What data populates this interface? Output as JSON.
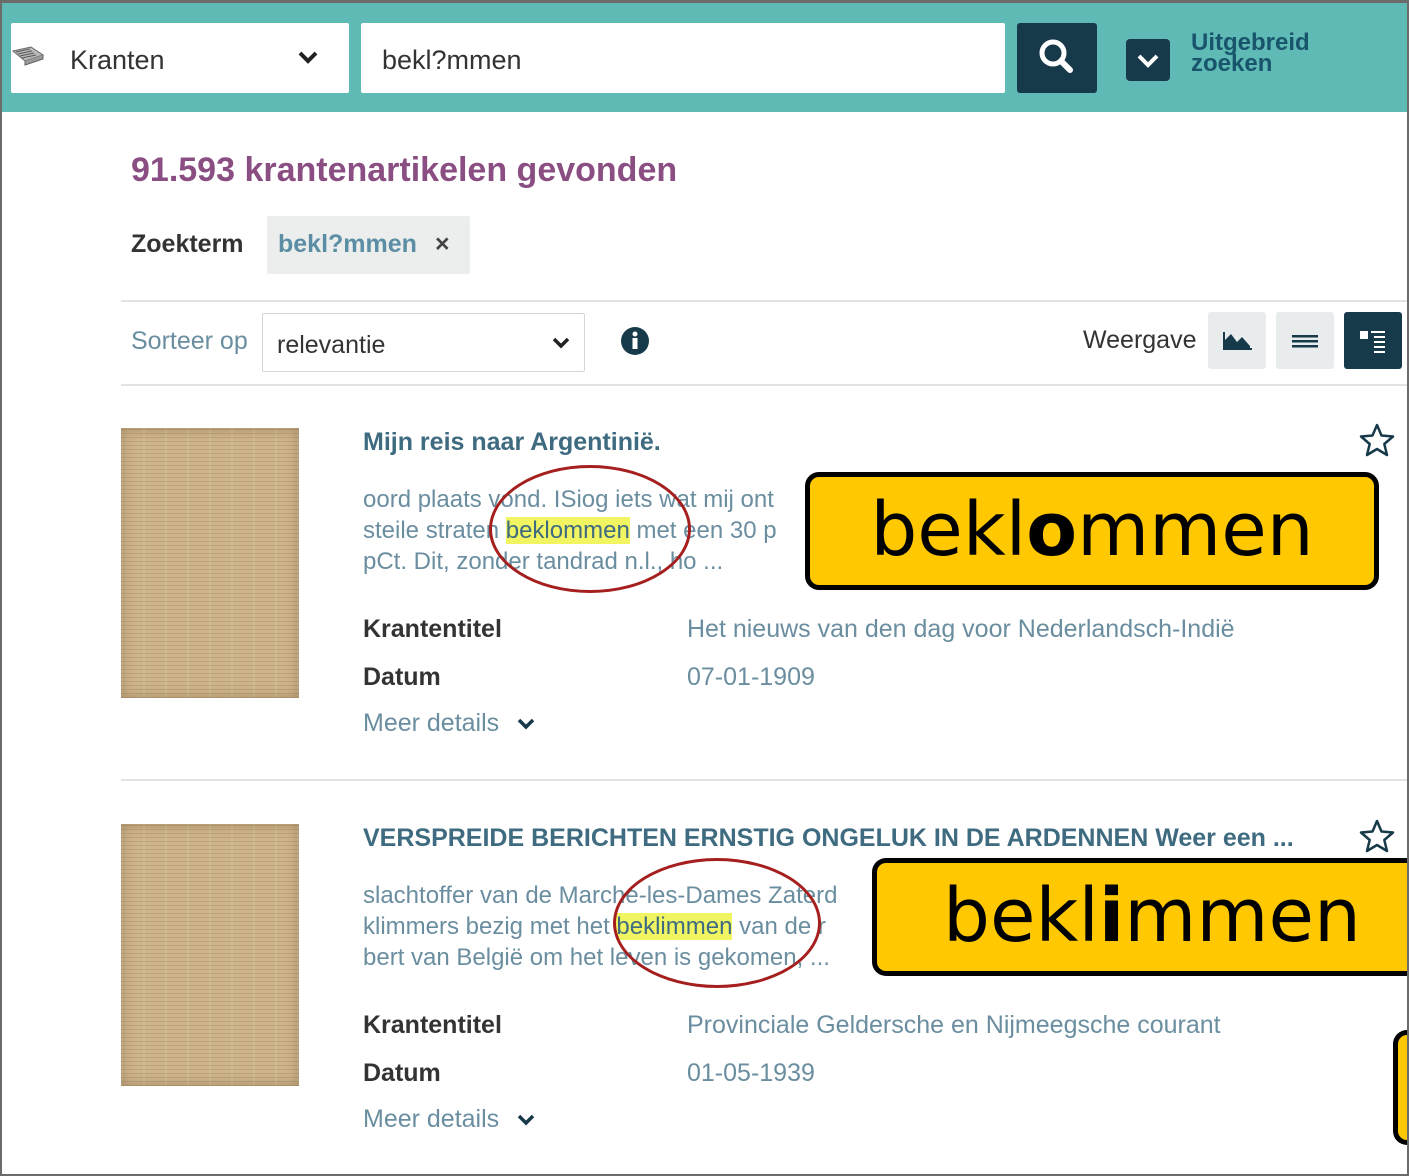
{
  "topbar": {
    "collection_label": "Kranten",
    "search_value": "bekl?mmen",
    "advanced_label": "Uitgebreid zoeken",
    "advanced_line1": "Uitgebreid",
    "advanced_line2": "zoeken"
  },
  "results": {
    "count_text": "91.593 krantenartikelen gevonden",
    "zoekterm_label": "Zoekterm",
    "zoekterm_value": "bekl?mmen",
    "zoekterm_remove": "×"
  },
  "toolbar": {
    "sort_label": "Sorteer op",
    "sort_value": "relevantie",
    "weergave_label": "Weergave"
  },
  "items": [
    {
      "title": "Mijn reis naar Argentinië.",
      "snippet_l1": "oord plaats vond. ISiog iets wat mij ont",
      "snippet_l2_pre": "steile straten ",
      "snippet_l2_hl": "beklommen",
      "snippet_l2_post": " met een 30 p",
      "snippet_l3": "pCt. Dit, zonder tandrad n.l., ho ...",
      "krantentitel_label": "Krantentitel",
      "krantentitel": "Het nieuws van den dag voor Nederlandsch-Indië",
      "datum_label": "Datum",
      "datum": "07-01-1909",
      "more_label": "Meer details"
    },
    {
      "title": "VERSPREIDE BERICHTEN ERNSTIG ONGELUK IN DE ARDENNEN Weer een ...",
      "snippet_l1": "slachtoffer van de Marche-les-Dames Zaterd",
      "snippet_l2_pre": "klimmers bezig met het ",
      "snippet_l2_hl": "beklimmen",
      "snippet_l2_post": " van de r",
      "snippet_l3": "bert van België om het leven is gekomen, ...",
      "krantentitel_label": "Krantentitel",
      "krantentitel": "Provinciale Geldersche en Nijmeegsche courant",
      "datum_label": "Datum",
      "datum": "01-05-1939",
      "more_label": "Meer details"
    }
  ],
  "callouts": [
    {
      "pre": "bekl",
      "bold": "o",
      "post": "mmen"
    },
    {
      "pre": "bekl",
      "bold": "i",
      "post": "mmen"
    }
  ],
  "colors": {
    "topbar": "#5fb9b5",
    "dark_button": "#173a4a",
    "count_purple": "#8a4e83",
    "highlight": "#f2f562",
    "callout": "#ffc800",
    "annotation_circle": "#a61f1f"
  }
}
